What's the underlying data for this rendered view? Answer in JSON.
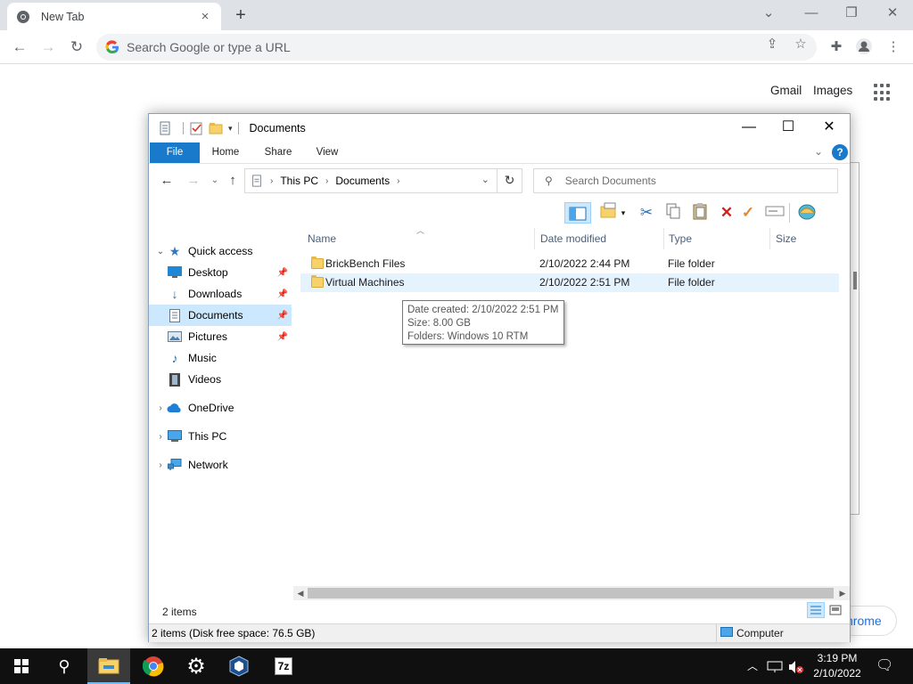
{
  "browser": {
    "tab_title": "New Tab",
    "tab_close": "×",
    "new_tab": "+",
    "omnibox_placeholder": "Search Google or type a URL",
    "links": {
      "gmail": "Gmail",
      "images": "Images"
    },
    "peek_text": "hrome"
  },
  "explorer": {
    "title": "Documents",
    "ribbon_tabs": [
      "File",
      "Home",
      "Share",
      "View"
    ],
    "help": "?",
    "address": {
      "crumbs": [
        "This PC",
        "Documents"
      ]
    },
    "search_placeholder": "Search Documents",
    "nav": [
      {
        "label": "Quick access",
        "icon": "star-icon"
      },
      {
        "label": "Desktop",
        "icon": "desktop-icon",
        "pinned": true
      },
      {
        "label": "Downloads",
        "icon": "download-icon",
        "pinned": true
      },
      {
        "label": "Documents",
        "icon": "documents-icon",
        "pinned": true,
        "selected": true
      },
      {
        "label": "Pictures",
        "icon": "pictures-icon",
        "pinned": true
      },
      {
        "label": "Music",
        "icon": "music-icon"
      },
      {
        "label": "Videos",
        "icon": "videos-icon"
      },
      {
        "label": "OneDrive",
        "icon": "cloud-icon"
      },
      {
        "label": "This PC",
        "icon": "computer-icon"
      },
      {
        "label": "Network",
        "icon": "network-icon"
      }
    ],
    "columns": [
      "Name",
      "Date modified",
      "Type",
      "Size"
    ],
    "files": [
      {
        "name": "BrickBench Files",
        "date": "2/10/2022 2:44 PM",
        "type": "File folder",
        "size": ""
      },
      {
        "name": "Virtual Machines",
        "date": "2/10/2022 2:51 PM",
        "type": "File folder",
        "size": ""
      }
    ],
    "tooltip": {
      "line1": "Date created: 2/10/2022 2:51 PM",
      "line2": "Size: 8.00 GB",
      "line3": "Folders: Windows 10 RTM"
    },
    "item_count": "2 items",
    "status_text": "2 items (Disk free space: 76.5 GB)",
    "status_location": "Computer"
  },
  "taskbar": {
    "clock_time": "3:19 PM",
    "clock_date": "2/10/2022",
    "apps": [
      "file-explorer",
      "chrome",
      "settings",
      "virtualbox",
      "7zip"
    ],
    "sevenzip_label": "7z"
  }
}
